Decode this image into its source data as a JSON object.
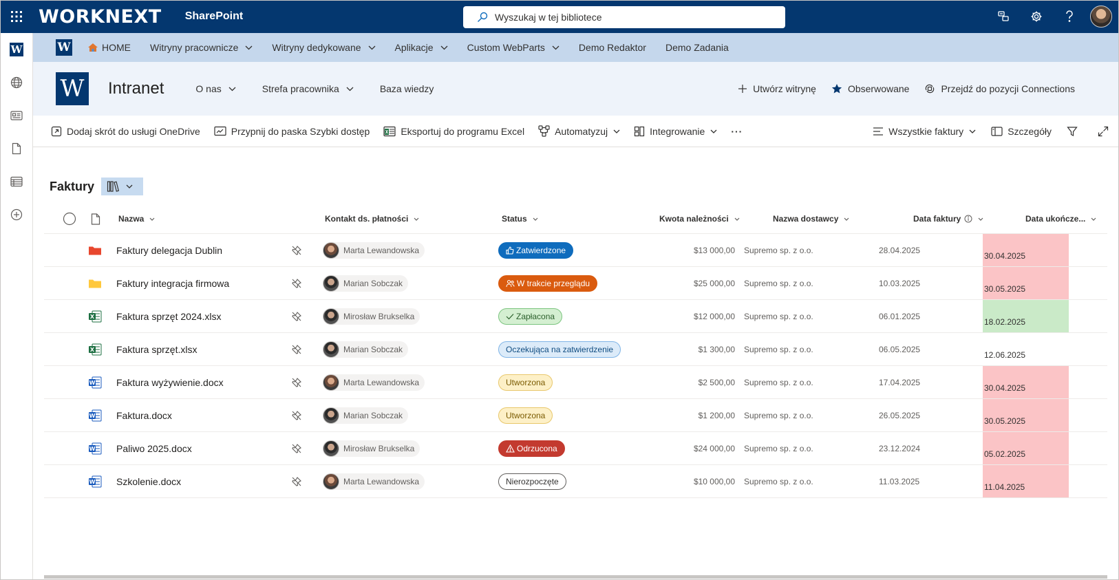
{
  "suite": {
    "brand": "WORKNEXT",
    "product": "SharePoint",
    "search_placeholder": "Wyszukaj w tej bibliotece",
    "icons": [
      "waffle-icon",
      "chat-icon",
      "settings-icon",
      "help-icon"
    ]
  },
  "hubnav": {
    "logo": "W",
    "items": [
      {
        "label": "HOME",
        "dropdown": false,
        "icon": "home-icon"
      },
      {
        "label": "Witryny pracownicze",
        "dropdown": true
      },
      {
        "label": "Witryny dedykowane",
        "dropdown": true
      },
      {
        "label": "Aplikacje",
        "dropdown": true
      },
      {
        "label": "Custom WebParts",
        "dropdown": true
      },
      {
        "label": "Demo Redaktor",
        "dropdown": false
      },
      {
        "label": "Demo Zadania",
        "dropdown": false
      }
    ]
  },
  "site": {
    "logo": "W",
    "title": "Intranet",
    "nav": [
      {
        "label": "O nas",
        "dropdown": true
      },
      {
        "label": "Strefa pracownika",
        "dropdown": true
      },
      {
        "label": "Baza wiedzy",
        "dropdown": false
      }
    ],
    "actions": {
      "create": "Utwórz witrynę",
      "follow": "Obserwowane",
      "connections": "Przejdź do pozycji Connections"
    }
  },
  "commands": {
    "onedrive": "Dodaj skrót do usługi OneDrive",
    "pin": "Przypnij do paska Szybki dostęp",
    "excel": "Eksportuj do programu Excel",
    "automate": "Automatyzuj",
    "integrate": "Integrowanie",
    "more": "···",
    "view": "Wszystkie faktury",
    "details": "Szczegóły"
  },
  "list": {
    "title": "Faktury",
    "columns": {
      "name": "Nazwa",
      "contact": "Kontakt ds. płatności",
      "status": "Status",
      "amount": "Kwota należności",
      "vendor": "Nazwa dostawcy",
      "invoice_date": "Data faktury",
      "due_date": "Data ukończe..."
    },
    "rows": [
      {
        "type": "folder",
        "color": "#e8472e",
        "name": "Faktury delegacja Dublin",
        "contact": "Marta Lewandowska",
        "gender": "f",
        "status": "Zatwierdzone",
        "status_kind": "approved",
        "amount": "$13 000,00",
        "vendor": "Supremo sp. z o.o.",
        "invoice_date": "28.04.2025",
        "due_date": "30.04.2025",
        "due_bg": "#fbc4c6"
      },
      {
        "type": "folder",
        "color": "#ffc83d",
        "name": "Faktury integracja firmowa",
        "contact": "Marian Sobczak",
        "gender": "m",
        "status": "W trakcie przeglądu",
        "status_kind": "review",
        "amount": "$25 000,00",
        "vendor": "Supremo sp. z o.o.",
        "invoice_date": "10.03.2025",
        "due_date": "30.05.2025",
        "due_bg": "#fbc4c6"
      },
      {
        "type": "excel",
        "color": "#1d6f42",
        "name": "Faktura sprzęt 2024.xlsx",
        "contact": "Mirosław Brukselka",
        "gender": "m",
        "status": "Zapłacona",
        "status_kind": "paid",
        "amount": "$12 000,00",
        "vendor": "Supremo sp. z o.o.",
        "invoice_date": "06.01.2025",
        "due_date": "18.02.2025",
        "due_bg": "#caeac8"
      },
      {
        "type": "excel",
        "color": "#1d6f42",
        "name": "Faktura sprzęt.xlsx",
        "contact": "Marian Sobczak",
        "gender": "m",
        "status": "Oczekująca na zatwierdzenie",
        "status_kind": "pending",
        "amount": "$1 300,00",
        "vendor": "Supremo sp. z o.o.",
        "invoice_date": "06.05.2025",
        "due_date": "12.06.2025",
        "due_bg": "#ffffff"
      },
      {
        "type": "word",
        "color": "#185abd",
        "name": "Faktura wyżywienie.docx",
        "contact": "Marta Lewandowska",
        "gender": "f",
        "status": "Utworzona",
        "status_kind": "created",
        "amount": "$2 500,00",
        "vendor": "Supremo sp. z o.o.",
        "invoice_date": "17.04.2025",
        "due_date": "30.04.2025",
        "due_bg": "#fbc4c6"
      },
      {
        "type": "word",
        "color": "#185abd",
        "name": "Faktura.docx",
        "contact": "Marian Sobczak",
        "gender": "m",
        "status": "Utworzona",
        "status_kind": "created",
        "amount": "$1 200,00",
        "vendor": "Supremo sp. z o.o.",
        "invoice_date": "26.05.2025",
        "due_date": "30.05.2025",
        "due_bg": "#fbc4c6"
      },
      {
        "type": "word",
        "color": "#185abd",
        "name": "Paliwo 2025.docx",
        "contact": "Mirosław Brukselka",
        "gender": "m",
        "status": "Odrzucona",
        "status_kind": "rejected",
        "amount": "$24 000,00",
        "vendor": "Supremo sp. z o.o.",
        "invoice_date": "23.12.2024",
        "due_date": "05.02.2025",
        "due_bg": "#fbc4c6"
      },
      {
        "type": "word",
        "color": "#185abd",
        "name": "Szkolenie.docx",
        "contact": "Marta Lewandowska",
        "gender": "f",
        "status": "Nierozpoczęte",
        "status_kind": "notstarted",
        "amount": "$10 000,00",
        "vendor": "Supremo sp. z o.o.",
        "invoice_date": "11.03.2025",
        "due_date": "11.04.2025",
        "due_bg": "#fbc4c6"
      }
    ]
  },
  "status_styles": {
    "approved": {
      "bg": "#0f6cbd",
      "fg": "#ffffff",
      "border": "#0f6cbd",
      "icon": "thumbs-up-icon"
    },
    "review": {
      "bg": "#da5b0f",
      "fg": "#ffffff",
      "border": "#da5b0f",
      "icon": "people-icon"
    },
    "paid": {
      "bg": "#d4efd1",
      "fg": "#2b5f2b",
      "border": "#7bc47f",
      "icon": "check-icon"
    },
    "pending": {
      "bg": "#dcebf9",
      "fg": "#0f4c81",
      "border": "#7fb4e6",
      "icon": ""
    },
    "created": {
      "bg": "#fdf0c7",
      "fg": "#7a5a00",
      "border": "#e8c76b",
      "icon": ""
    },
    "rejected": {
      "bg": "#c33a2f",
      "fg": "#ffffff",
      "border": "#c33a2f",
      "icon": "warning-icon"
    },
    "notstarted": {
      "bg": "#ffffff",
      "fg": "#323130",
      "border": "#605e5c",
      "icon": ""
    }
  }
}
